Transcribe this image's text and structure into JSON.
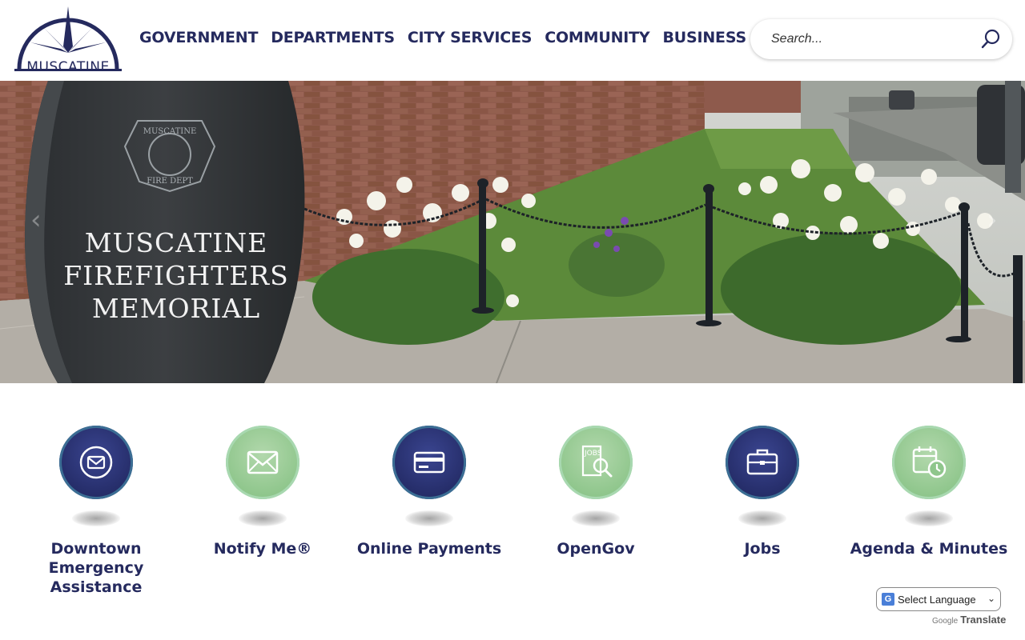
{
  "logo": {
    "text": "MUSCATINE"
  },
  "nav": {
    "items": [
      {
        "label": "GOVERNMENT"
      },
      {
        "label": "DEPARTMENTS"
      },
      {
        "label": "CITY SERVICES"
      },
      {
        "label": "COMMUNITY"
      },
      {
        "label": "BUSINESS"
      }
    ]
  },
  "search": {
    "placeholder": "Search...",
    "icon": "search-icon"
  },
  "hero": {
    "stone_line1": "MUSCATINE",
    "stone_line2": "FIREFIGHTERS",
    "stone_line3": "MEMORIAL",
    "badge_line1": "MUSCATINE",
    "badge_line2": "FIRE DEPT",
    "prev_arrow": "‹",
    "next_arrow": "›"
  },
  "quick_links": [
    {
      "label": "Downtown Emergency Assistance",
      "icon": "mail-circle-icon",
      "style": "dark"
    },
    {
      "label": "Notify Me®",
      "icon": "envelope-icon",
      "style": "light"
    },
    {
      "label": "Online Payments",
      "icon": "credit-card-icon",
      "style": "dark"
    },
    {
      "label": "OpenGov",
      "icon": "jobs-search-icon",
      "style": "light"
    },
    {
      "label": "Jobs",
      "icon": "briefcase-icon",
      "style": "dark"
    },
    {
      "label": "Agenda & Minutes",
      "icon": "calendar-clock-icon",
      "style": "light"
    }
  ],
  "translate": {
    "select_label": "Select Language",
    "powered_by": "Google",
    "translate_label": "Translate",
    "caret": "⌄"
  },
  "colors": {
    "brand_navy": "#252a5e",
    "accent_green": "#8fc68c"
  }
}
